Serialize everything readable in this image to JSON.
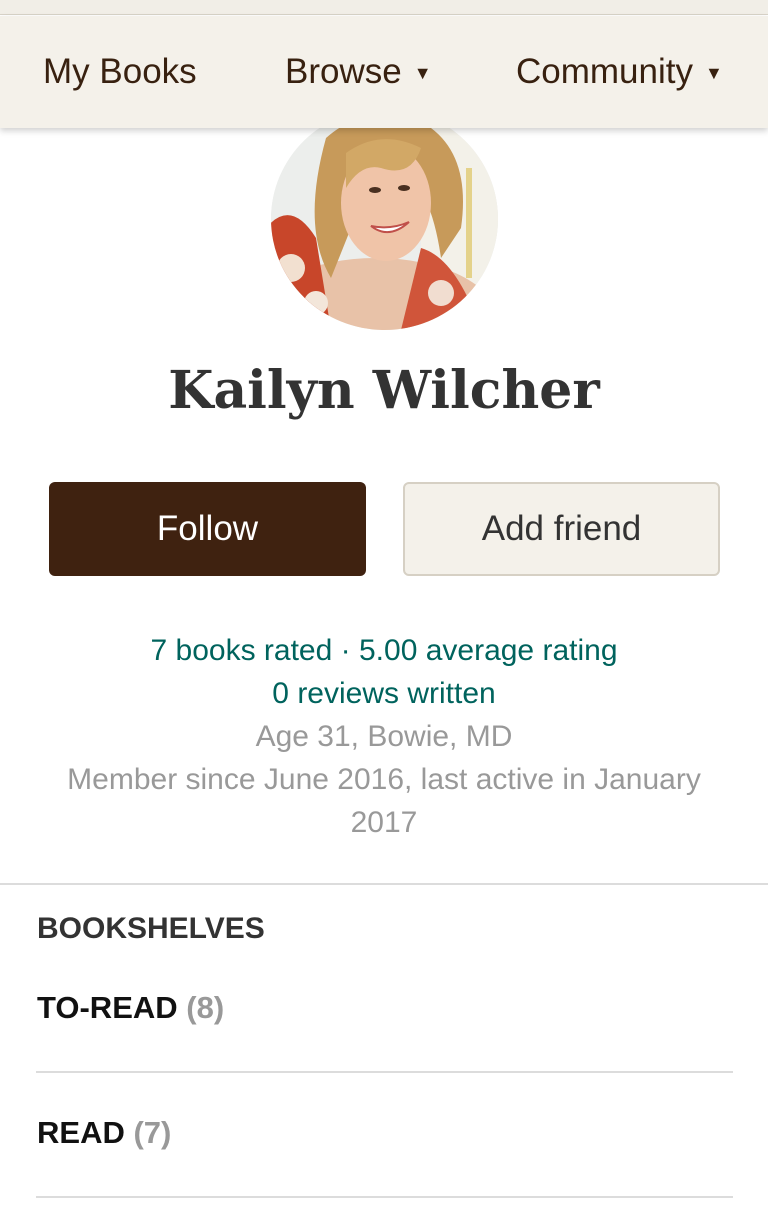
{
  "nav": {
    "my_books": "My Books",
    "browse": "Browse",
    "community": "Community",
    "caret": "▼"
  },
  "profile": {
    "name": "Kailyn Wilcher",
    "follow_label": "Follow",
    "add_friend_label": "Add friend",
    "books_rated": "7 books rated",
    "separator": "·",
    "average_rating": "5.00 average rating",
    "reviews_written": "0 reviews written",
    "age_location": "Age 31, Bowie, MD",
    "member_since_line1": "Member since June 2016, last active in January",
    "member_since_line2": "2017"
  },
  "bookshelves": {
    "heading": "BOOKSHELVES",
    "items": [
      {
        "label": "TO-READ",
        "count": "(8)"
      },
      {
        "label": "READ",
        "count": "(7)"
      }
    ]
  },
  "colors": {
    "nav_bg": "#f4f1ea",
    "brand_brown": "#382110",
    "follow_bg": "#3f2210",
    "link_teal": "#00635d",
    "muted_gray": "#999999"
  },
  "icons": {
    "dropdown": "caret-down-icon"
  }
}
